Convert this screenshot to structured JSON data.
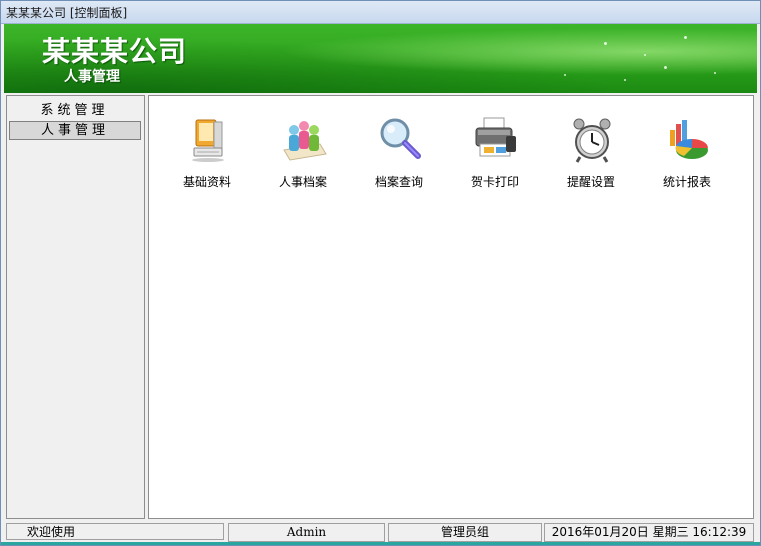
{
  "window": {
    "title": "某某某公司 [控制面板]"
  },
  "banner": {
    "company": "某某某公司",
    "module": "人事管理"
  },
  "sidebar": {
    "items": [
      {
        "label": "系统管理",
        "selected": false
      },
      {
        "label": "人事管理",
        "selected": true
      }
    ]
  },
  "main": {
    "tiles": [
      {
        "label": "基础资料",
        "icon": "computer-icon"
      },
      {
        "label": "人事档案",
        "icon": "people-icon"
      },
      {
        "label": "档案查询",
        "icon": "magnifier-icon"
      },
      {
        "label": "贺卡打印",
        "icon": "printer-icon"
      },
      {
        "label": "提醒设置",
        "icon": "alarm-clock-icon"
      },
      {
        "label": "统计报表",
        "icon": "chart-icon"
      }
    ]
  },
  "status": {
    "welcome": "欢迎使用",
    "user": "Admin",
    "group": "管理员组",
    "datetime": "2016年01月20日 星期三 16:12:39"
  },
  "colors": {
    "banner_green": "#2da31c",
    "window_border": "#6f8fb6",
    "accent_teal": "#2aa6a0"
  }
}
